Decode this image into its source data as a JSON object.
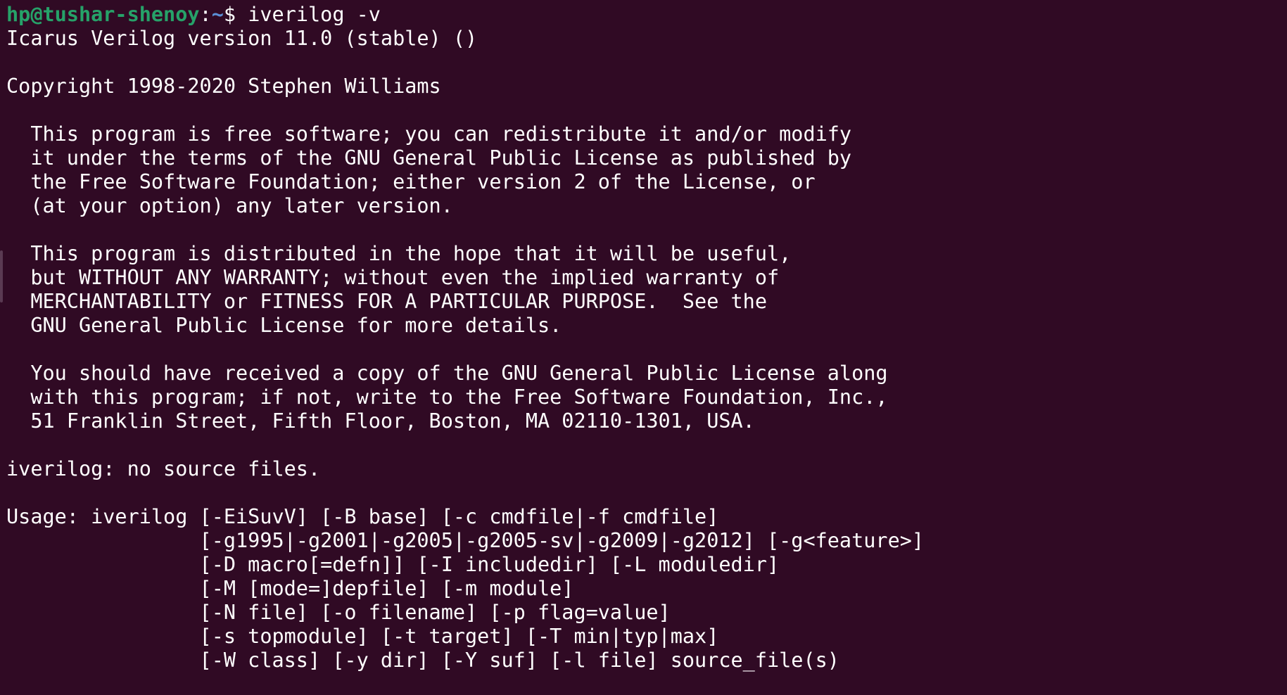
{
  "prompt": {
    "user_host": "hp@tushar-shenoy",
    "separator": ":",
    "path": "~",
    "symbol": "$ ",
    "command": "iverilog -v"
  },
  "output_lines": [
    "Icarus Verilog version 11.0 (stable) ()",
    "",
    "Copyright 1998-2020 Stephen Williams",
    "",
    "  This program is free software; you can redistribute it and/or modify",
    "  it under the terms of the GNU General Public License as published by",
    "  the Free Software Foundation; either version 2 of the License, or",
    "  (at your option) any later version.",
    "",
    "  This program is distributed in the hope that it will be useful,",
    "  but WITHOUT ANY WARRANTY; without even the implied warranty of",
    "  MERCHANTABILITY or FITNESS FOR A PARTICULAR PURPOSE.  See the",
    "  GNU General Public License for more details.",
    "",
    "  You should have received a copy of the GNU General Public License along",
    "  with this program; if not, write to the Free Software Foundation, Inc.,",
    "  51 Franklin Street, Fifth Floor, Boston, MA 02110-1301, USA.",
    "",
    "iverilog: no source files.",
    "",
    "Usage: iverilog [-EiSuvV] [-B base] [-c cmdfile|-f cmdfile]",
    "                [-g1995|-g2001|-g2005|-g2005-sv|-g2009|-g2012] [-g<feature>]",
    "                [-D macro[=defn]] [-I includedir] [-L moduledir]",
    "                [-M [mode=]depfile] [-m module]",
    "                [-N file] [-o filename] [-p flag=value]",
    "                [-s topmodule] [-t target] [-T min|typ|max]",
    "                [-W class] [-y dir] [-Y suf] [-l file] source_file(s)"
  ],
  "colors": {
    "background": "#300a24",
    "prompt_user": "#26a269",
    "prompt_path": "#5b8fd6",
    "text": "#ffffff"
  }
}
